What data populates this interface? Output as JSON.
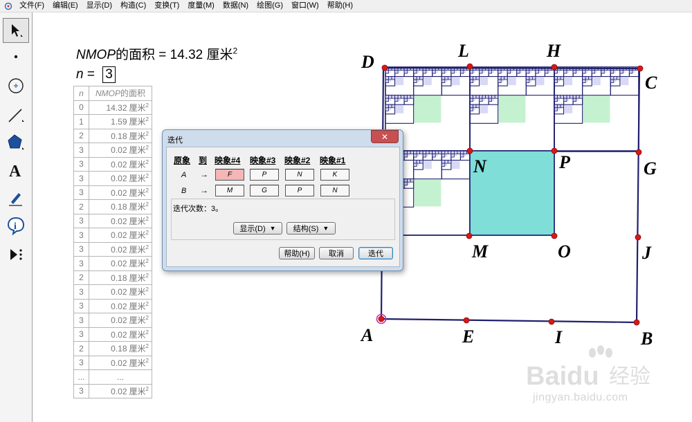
{
  "menu": [
    "文件(F)",
    "编辑(E)",
    "显示(D)",
    "构造(C)",
    "变换(T)",
    "度量(M)",
    "数据(N)",
    "绘图(G)",
    "窗口(W)",
    "帮助(H)"
  ],
  "toolbox": [
    "arrow-tool",
    "point-tool",
    "compass-tool",
    "straightedge-tool",
    "polygon-tool",
    "text-tool",
    "marker-tool",
    "info-tool",
    "custom-tool"
  ],
  "measurement": {
    "name": "NMOP",
    "suffix": "的面积 = 14.32 厘米",
    "sup": "2"
  },
  "parameter": {
    "name": "n",
    "eq": " = ",
    "value": "3"
  },
  "table": {
    "col_n": "n",
    "col_area_name": "NMOP",
    "col_area_suffix": "的面积",
    "unit": "厘米",
    "sup": "2",
    "rows": [
      {
        "n": "0",
        "v": "14.32"
      },
      {
        "n": "1",
        "v": "1.59"
      },
      {
        "n": "2",
        "v": "0.18"
      },
      {
        "n": "3",
        "v": "0.02"
      },
      {
        "n": "3",
        "v": "0.02"
      },
      {
        "n": "3",
        "v": "0.02"
      },
      {
        "n": "3",
        "v": "0.02"
      },
      {
        "n": "2",
        "v": "0.18"
      },
      {
        "n": "3",
        "v": "0.02"
      },
      {
        "n": "3",
        "v": "0.02"
      },
      {
        "n": "3",
        "v": "0.02"
      },
      {
        "n": "3",
        "v": "0.02"
      },
      {
        "n": "2",
        "v": "0.18"
      },
      {
        "n": "3",
        "v": "0.02"
      },
      {
        "n": "3",
        "v": "0.02"
      },
      {
        "n": "3",
        "v": "0.02"
      },
      {
        "n": "3",
        "v": "0.02"
      },
      {
        "n": "2",
        "v": "0.18"
      },
      {
        "n": "3",
        "v": "0.02"
      },
      {
        "n": "...",
        "v": "..."
      },
      {
        "n": "3",
        "v": "0.02"
      }
    ]
  },
  "points": [
    "A",
    "B",
    "C",
    "D",
    "E",
    "G",
    "H",
    "I",
    "J",
    "L",
    "M",
    "N",
    "O",
    "P"
  ],
  "dialog": {
    "title": "迭代",
    "close": "✕",
    "headers": [
      "原象",
      "到",
      "映象#4",
      "映象#3",
      "映象#2",
      "映象#1"
    ],
    "rows": [
      {
        "pre": "A",
        "arrow": "→",
        "maps": [
          "F",
          "P",
          "N",
          "K"
        ]
      },
      {
        "pre": "B",
        "arrow": "→",
        "maps": [
          "M",
          "G",
          "P",
          "N"
        ]
      }
    ],
    "iterations": "迭代次数：3。",
    "display_btn": "显示(D)",
    "structure_btn": "结构(S)",
    "help_btn": "帮助(H)",
    "cancel_btn": "取消",
    "iterate_btn": "迭代"
  },
  "watermark": {
    "brand": "Bai",
    "brand2": "du",
    "cn": "经验",
    "url": "jingyan.baidu.com"
  },
  "colors": {
    "square_fill": "#7fded8",
    "small_fill": "#c4f1cf",
    "line": "#1f1f6e",
    "point": "#d81818",
    "tiny_fill": "#cfd0f3"
  }
}
